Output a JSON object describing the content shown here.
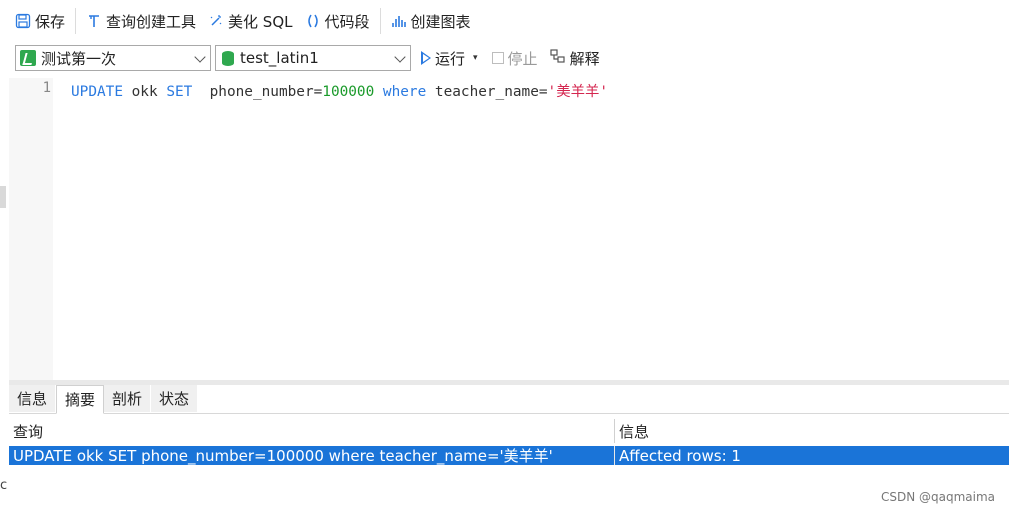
{
  "toolbar": {
    "save": "保存",
    "query_builder": "查询创建工具",
    "beautify": "美化 SQL",
    "snippet": "代码段",
    "create_chart": "创建图表"
  },
  "row2": {
    "connection": "测试第一次",
    "database": "test_latin1",
    "run": "运行",
    "stop": "停止",
    "explain": "解释"
  },
  "editor": {
    "line_number": "1",
    "tokens": {
      "kw_update": "UPDATE",
      "table": " okk ",
      "kw_set": "SET",
      "col": "  phone_number=",
      "num": "100000",
      "kw_where": " where",
      "col2": " teacher_name=",
      "str": "'美羊羊'"
    }
  },
  "tabs": [
    "信息",
    "摘要",
    "剖析",
    "状态"
  ],
  "result": {
    "headers": [
      "查询",
      "信息"
    ],
    "row": [
      "UPDATE okk SET  phone_number=100000 where teacher_name='美羊羊'",
      "Affected rows: 1"
    ]
  },
  "watermark": "CSDN @qaqmaima",
  "left_fragment": "c",
  "colors": {
    "accent": "#1a74d8",
    "keyword": "#2b7ae0",
    "number": "#1a9a2a",
    "string": "#d4264f",
    "db": "#2fa84f"
  }
}
